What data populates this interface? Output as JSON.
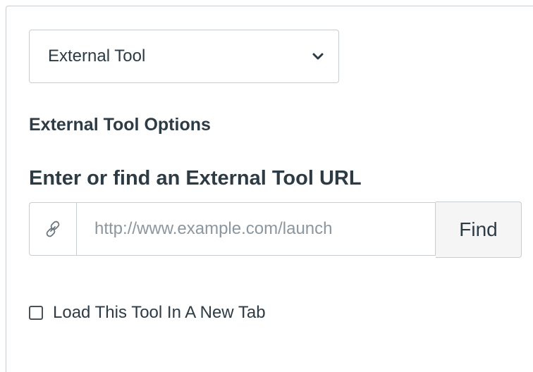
{
  "tool_select": {
    "selected_value": "External Tool",
    "icon": "chevron-down-icon"
  },
  "options_section": {
    "title": "External Tool Options"
  },
  "url_section": {
    "heading": "Enter or find an External Tool URL",
    "url_value": "",
    "url_placeholder": "http://www.example.com/launch",
    "link_icon": "link-icon",
    "find_label": "Find"
  },
  "new_tab_option": {
    "label": "Load This Tool In A New Tab",
    "checked": false
  }
}
